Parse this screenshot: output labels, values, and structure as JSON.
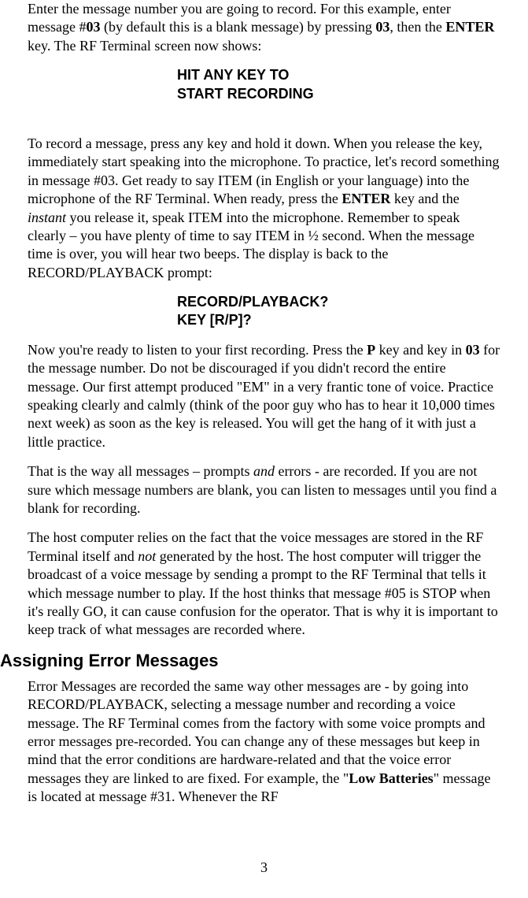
{
  "paragraphs": {
    "p1_a": "Enter the message number you are going to record. For this example, enter message #",
    "p1_b": "03",
    "p1_c": " (by default this is a blank message) by pressing ",
    "p1_d": "03",
    "p1_e": ", then the ",
    "p1_f": "ENTER",
    "p1_g": " key. The RF Terminal screen now shows:",
    "code1_line1": "HIT ANY KEY TO",
    "code1_line2": "START RECORDING",
    "p2_a": "To record a message, press any key and hold it down. When you release the key, immediately start speaking into the microphone. To practice, let's record something in message #03. Get ready to say ITEM (in English or your language) into the microphone of the RF Terminal. When ready, press the ",
    "p2_b": "ENTER",
    "p2_c": " key and the ",
    "p2_d": "instant",
    "p2_e": " you release it, speak ITEM into the microphone. Remember to speak clearly – you have plenty of time to say ITEM in ½ second. When the message time is over, you will hear two beeps. The display is back to the RECORD/PLAYBACK prompt:",
    "code2_line1": "RECORD/PLAYBACK?",
    "code2_line2": "KEY [R/P]?",
    "p3_a": "Now you're ready to listen to your first recording. Press the ",
    "p3_b": "P",
    "p3_c": " key and key in ",
    "p3_d": "03",
    "p3_e": " for the message number.  Do not be discouraged if you didn't record the entire message. Our first attempt produced \"EM\" in a very frantic tone of voice. Practice speaking clearly and calmly (think of the poor guy who has to hear it 10,000 times next week) as soon as the key is released. You will get the hang of it with just a little practice.",
    "p4_a": "That is the way all messages – prompts ",
    "p4_b": "and",
    "p4_c": " errors - are recorded.  If you are not sure which message numbers are blank, you can listen to messages until you find a blank for recording.",
    "p5_a": "The host computer relies on the fact that the voice messages are stored in the RF Terminal itself and ",
    "p5_b": "not",
    "p5_c": " generated by the host. The host computer will trigger the broadcast of a voice message by sending a prompt to the RF Terminal that tells it which message number to play. If the host thinks that message #05 is STOP when it's really GO, it can cause confusion for the operator. That is why it is important to keep track of what messages are recorded where.",
    "h2": "Assigning Error Messages",
    "p6_a": "Error Messages are recorded the same way other messages are - by going into RECORD/PLAYBACK, selecting a message number and recording a voice message.  The RF Terminal comes from the factory with some voice prompts and error messages pre-recorded. You can change any of these messages but keep in mind that the error conditions are hardware-related and that the voice error messages they are linked to are fixed. For example, the \"",
    "p6_b": "Low Batteries",
    "p6_c": "\" message is located at message #31. Whenever the RF"
  },
  "page_number": "3"
}
